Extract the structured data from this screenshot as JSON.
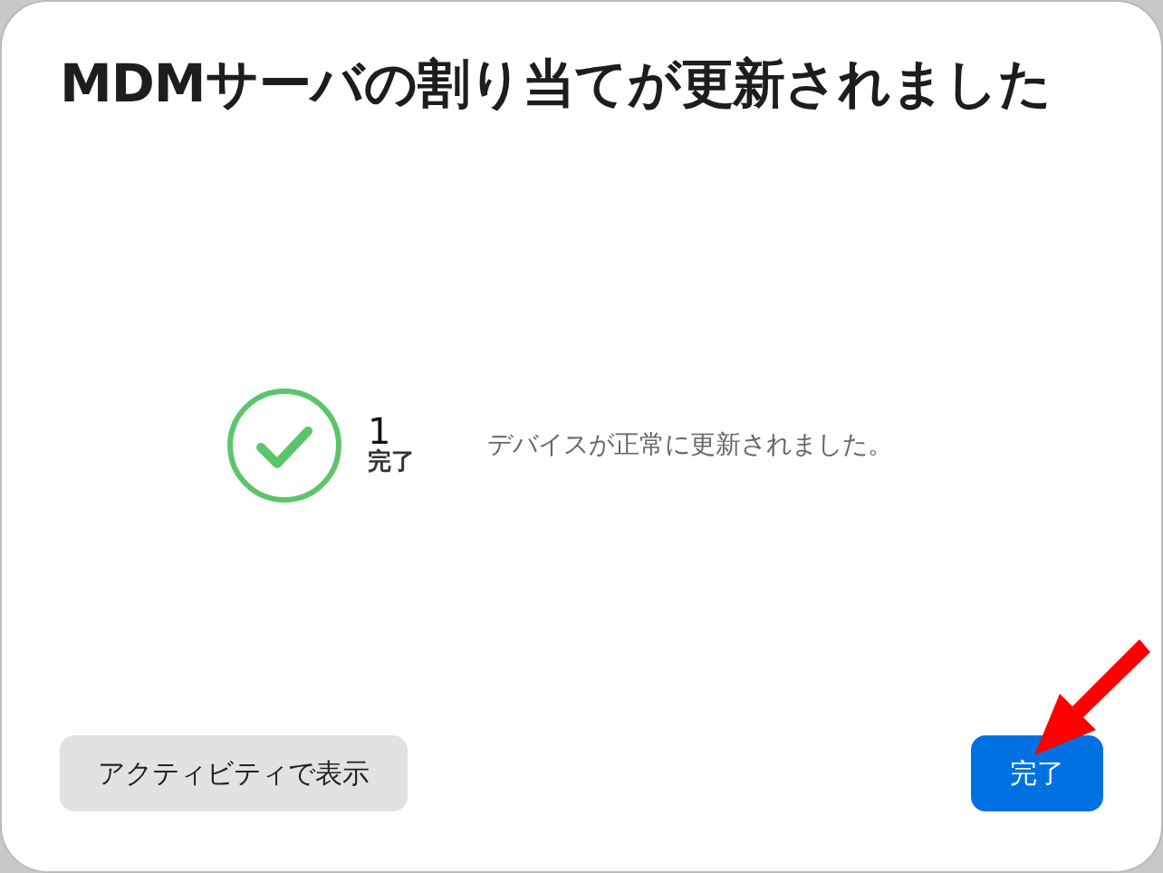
{
  "dialog": {
    "title": "MDMサーバの割り当てが更新されました"
  },
  "result": {
    "kind": "success",
    "count": "1",
    "label": "完了",
    "message": "デバイスが正常に更新されました。"
  },
  "buttons": [
    {
      "label": "アクティビティで表示",
      "kind": "secondary"
    },
    {
      "label": "完了",
      "kind": "primary"
    }
  ]
}
